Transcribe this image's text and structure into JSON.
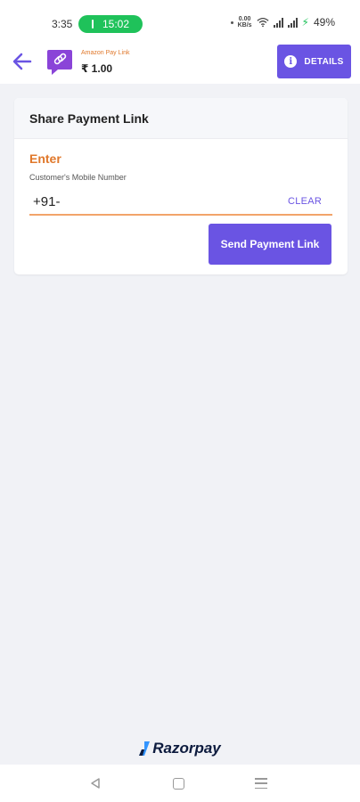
{
  "status_bar": {
    "time": "3:35",
    "call_time": "15:02",
    "net_speed_top": "0.00",
    "net_speed_unit": "KB/s",
    "battery": "49%"
  },
  "header": {
    "app_name": "Amazon Pay Link",
    "amount": "₹ 1.00",
    "details_label": "DETAILS"
  },
  "share_card": {
    "title": "Share Payment Link",
    "enter_label": "Enter",
    "field_label": "Customer's Mobile Number",
    "phone_value": "+91-",
    "clear_label": "CLEAR",
    "send_label": "Send Payment Link"
  },
  "footer": {
    "brand": "Razorpay"
  },
  "colors": {
    "accent": "#6a54e3",
    "orange": "#e0782b",
    "call_green": "#1fc25a"
  },
  "icons": {
    "back": "arrow-left-icon",
    "logo": "link-chat-icon",
    "info": "info-icon",
    "brand": "razorpay-mark-icon"
  }
}
